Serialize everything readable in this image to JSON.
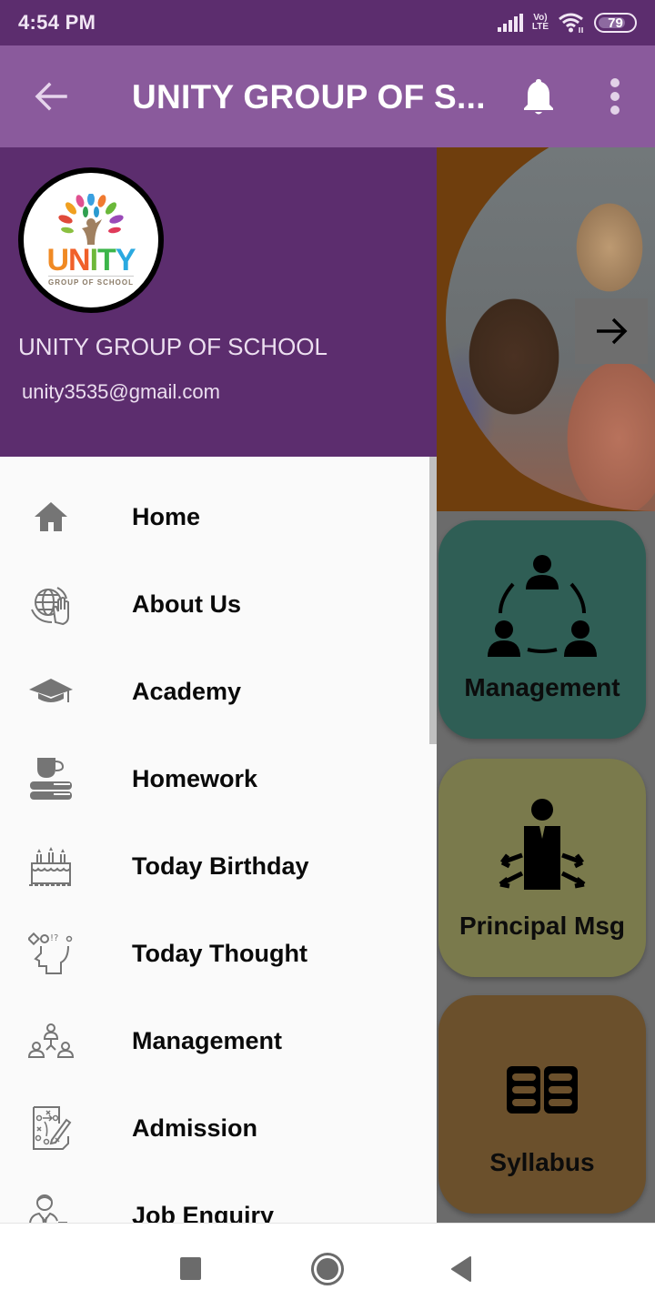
{
  "status_bar": {
    "time": "4:54 PM",
    "network_label": "Vo) LTE",
    "battery_level": 79,
    "battery_text": "79",
    "icons": [
      "signal-icon",
      "volte-icon",
      "wifi-icon",
      "battery-icon"
    ]
  },
  "app_bar": {
    "back_icon": "arrow-left-icon",
    "title": "UNITY GROUP OF S...",
    "notification_icon": "bell-icon",
    "more_icon": "more-vertical-icon"
  },
  "drawer": {
    "header": {
      "logo_text": "UNITY",
      "logo_letters": [
        {
          "char": "U",
          "color": "#f08a24"
        },
        {
          "char": "N",
          "color": "#f0602a"
        },
        {
          "char": "I",
          "color": "#6fb83a"
        },
        {
          "char": "T",
          "color": "#3cb54a"
        },
        {
          "char": "Y",
          "color": "#2aa9e0"
        }
      ],
      "logo_subtext": "GROUP OF SCHOOL",
      "school_name": "UNITY GROUP OF SCHOOL",
      "email": "unity3535@gmail.com"
    },
    "menu_items": [
      {
        "label": "Home",
        "icon": "home-icon"
      },
      {
        "label": "About Us",
        "icon": "globe-hand-icon"
      },
      {
        "label": "Academy",
        "icon": "graduation-cap-icon"
      },
      {
        "label": "Homework",
        "icon": "books-cup-icon"
      },
      {
        "label": "Today Birthday",
        "icon": "birthday-cake-icon"
      },
      {
        "label": "Today Thought",
        "icon": "thinking-head-icon"
      },
      {
        "label": "Management",
        "icon": "team-hierarchy-icon"
      },
      {
        "label": "Admission",
        "icon": "strategy-board-icon"
      },
      {
        "label": "Job Enquiry",
        "icon": "businessman-briefcase-icon"
      }
    ]
  },
  "background": {
    "banner_next_icon": "arrow-right-icon",
    "tiles": [
      {
        "label": "Management",
        "icon": "team-circle-icon",
        "color": "#2f5e55"
      },
      {
        "label": "Principal Msg",
        "icon": "principal-arrows-icon",
        "color": "#7a7a4c"
      },
      {
        "label": "Syllabus",
        "icon": "book-open-icon",
        "color": "#6b502c"
      }
    ]
  },
  "nav_bar": {
    "buttons": [
      "recents-square-icon",
      "home-circle-icon",
      "back-triangle-icon"
    ]
  },
  "colors": {
    "status_bar": "#5c2d6e",
    "app_bar": "#8a5a9c",
    "drawer_header": "#5c2d6e",
    "drawer_bg": "#fafafa",
    "icon_gray": "#757575"
  }
}
